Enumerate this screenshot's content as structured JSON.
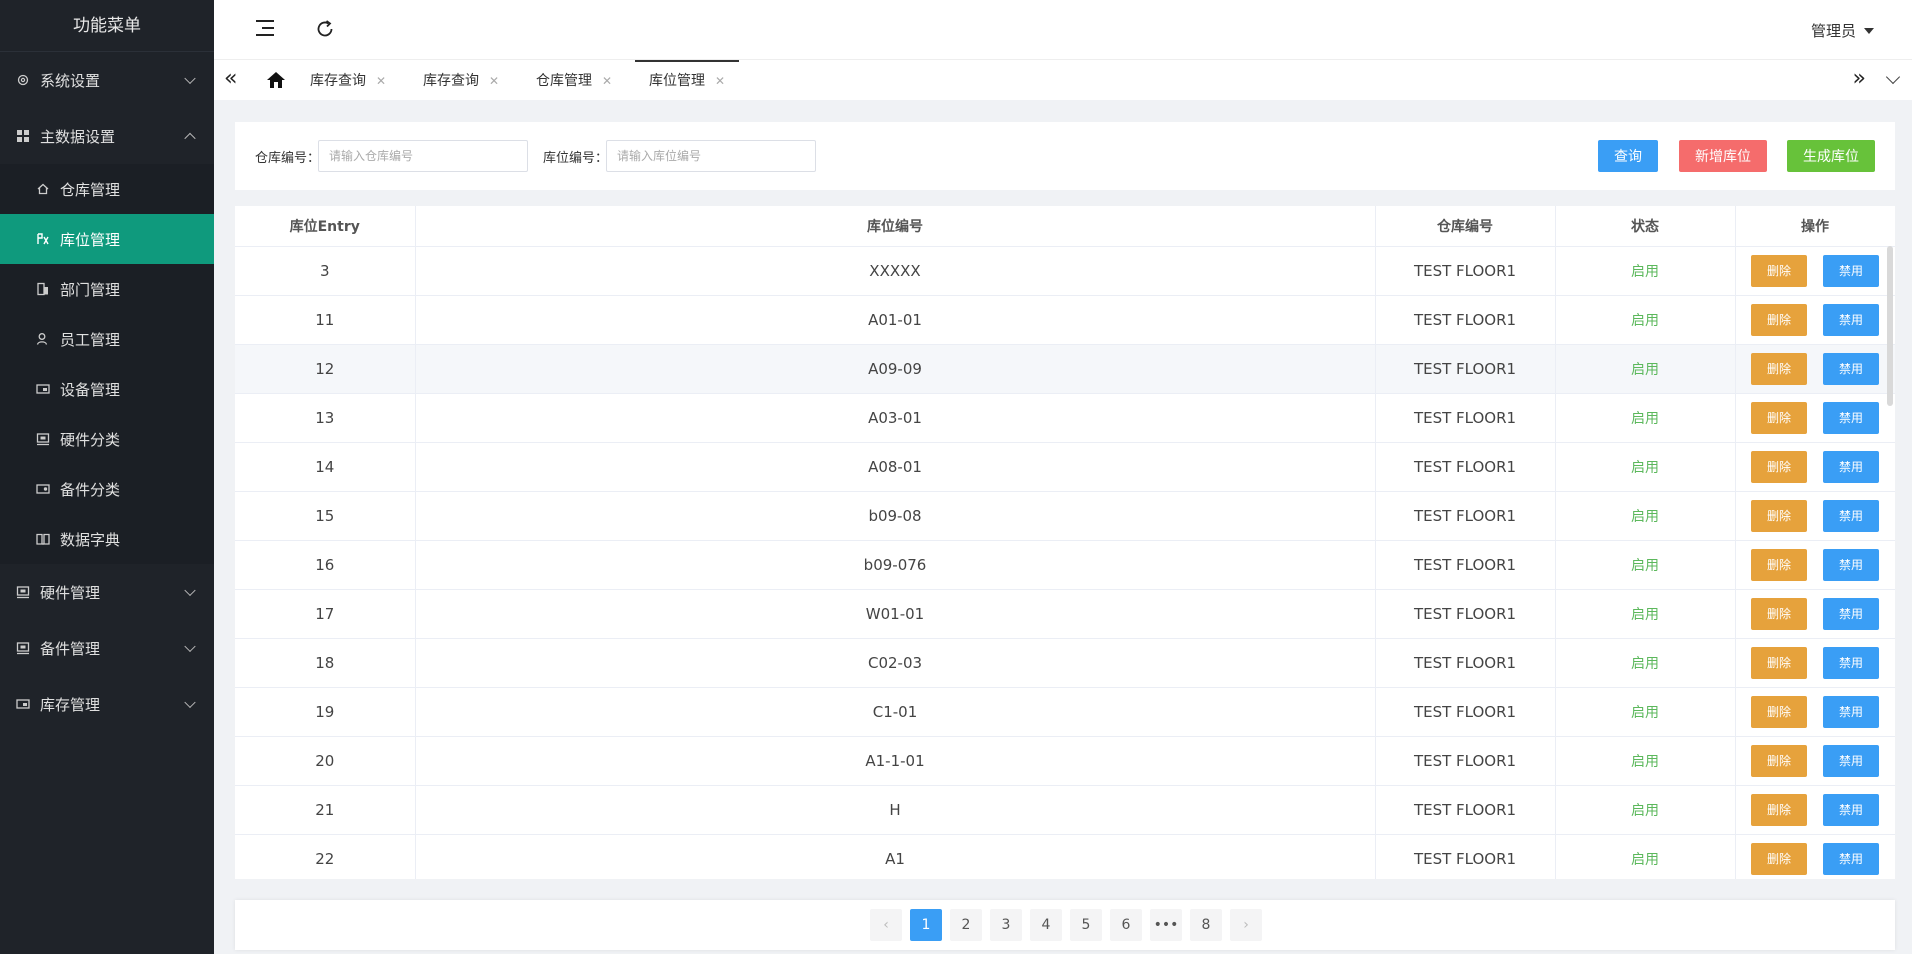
{
  "sidebar": {
    "title": "功能菜单",
    "groups": [
      {
        "label": "系统设置",
        "icon": "gear-icon",
        "expanded": false
      },
      {
        "label": "主数据设置",
        "icon": "grid-icon",
        "expanded": true,
        "items": [
          {
            "label": "仓库管理",
            "icon": "home-icon"
          },
          {
            "label": "库位管理",
            "icon": "location-icon",
            "active": true
          },
          {
            "label": "部门管理",
            "icon": "building-icon"
          },
          {
            "label": "员工管理",
            "icon": "user-icon"
          },
          {
            "label": "设备管理",
            "icon": "device-icon"
          },
          {
            "label": "硬件分类",
            "icon": "hardware-icon"
          },
          {
            "label": "备件分类",
            "icon": "parts-icon"
          },
          {
            "label": "数据字典",
            "icon": "book-icon"
          }
        ]
      },
      {
        "label": "硬件管理",
        "icon": "hardware-icon",
        "expanded": false
      },
      {
        "label": "备件管理",
        "icon": "parts-icon",
        "expanded": false
      },
      {
        "label": "库存管理",
        "icon": "inventory-icon",
        "expanded": false
      }
    ]
  },
  "header": {
    "user": "管理员"
  },
  "tabs": [
    {
      "label": "库存查询"
    },
    {
      "label": "库存查询"
    },
    {
      "label": "仓库管理"
    },
    {
      "label": "库位管理",
      "active": true
    }
  ],
  "filters": {
    "warehouse_label": "仓库编号：",
    "warehouse_placeholder": "请输入仓库编号",
    "location_label": "库位编号：",
    "location_placeholder": "请输入库位编号",
    "search_button": "查询",
    "add_button": "新增库位",
    "generate_button": "生成库位"
  },
  "table": {
    "columns": [
      "库位Entry",
      "库位编号",
      "仓库编号",
      "状态",
      "操作"
    ],
    "delete_label": "删除",
    "disable_label": "禁用",
    "rows": [
      {
        "entry": "3",
        "code": "XXXXX",
        "warehouse": "TEST FLOOR1",
        "status": "启用"
      },
      {
        "entry": "11",
        "code": "A01-01",
        "warehouse": "TEST FLOOR1",
        "status": "启用"
      },
      {
        "entry": "12",
        "code": "A09-09",
        "warehouse": "TEST FLOOR1",
        "status": "启用"
      },
      {
        "entry": "13",
        "code": "A03-01",
        "warehouse": "TEST FLOOR1",
        "status": "启用"
      },
      {
        "entry": "14",
        "code": "A08-01",
        "warehouse": "TEST FLOOR1",
        "status": "启用"
      },
      {
        "entry": "15",
        "code": "b09-08",
        "warehouse": "TEST FLOOR1",
        "status": "启用"
      },
      {
        "entry": "16",
        "code": "b09-076",
        "warehouse": "TEST FLOOR1",
        "status": "启用"
      },
      {
        "entry": "17",
        "code": "W01-01",
        "warehouse": "TEST FLOOR1",
        "status": "启用"
      },
      {
        "entry": "18",
        "code": "C02-03",
        "warehouse": "TEST FLOOR1",
        "status": "启用"
      },
      {
        "entry": "19",
        "code": "C1-01",
        "warehouse": "TEST FLOOR1",
        "status": "启用"
      },
      {
        "entry": "20",
        "code": "A1-1-01",
        "warehouse": "TEST FLOOR1",
        "status": "启用"
      },
      {
        "entry": "21",
        "code": "H",
        "warehouse": "TEST FLOOR1",
        "status": "启用"
      },
      {
        "entry": "22",
        "code": "A1",
        "warehouse": "TEST FLOOR1",
        "status": "启用"
      }
    ]
  },
  "pagination": {
    "pages": [
      "1",
      "2",
      "3",
      "4",
      "5",
      "6",
      "•••",
      "8"
    ],
    "current": "1",
    "prev": "‹",
    "next": "›"
  },
  "colors": {
    "sidebar_bg": "#1f2329",
    "active_item": "#0f9a7d",
    "primary": "#3a9ef5",
    "danger": "#f56c6c",
    "success": "#67c23a",
    "warning": "#e6a23c"
  }
}
